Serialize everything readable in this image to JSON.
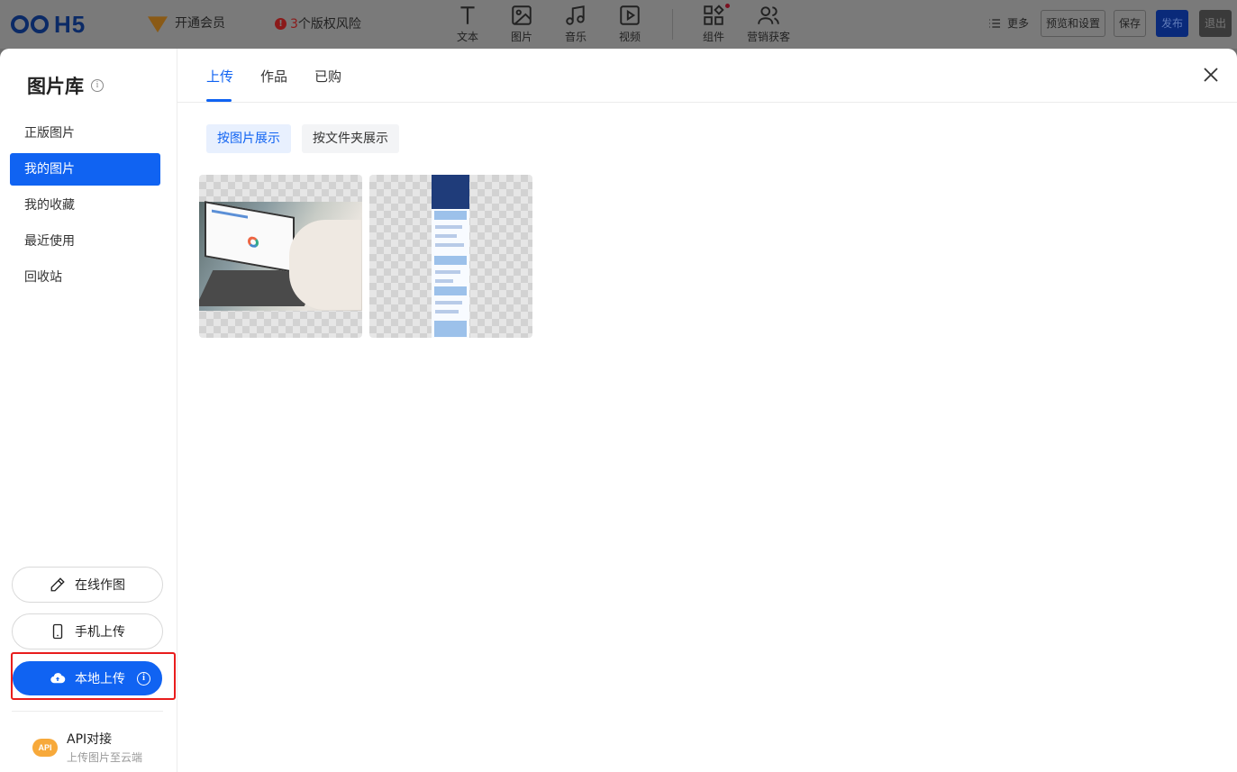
{
  "topbar": {
    "logo": "H5",
    "vip": "开通会员",
    "risk": {
      "count": "3",
      "text": "个版权风险"
    },
    "tools": [
      {
        "label": "文本",
        "icon": "text-icon"
      },
      {
        "label": "图片",
        "icon": "image-icon"
      },
      {
        "label": "音乐",
        "icon": "music-icon"
      },
      {
        "label": "视频",
        "icon": "video-icon"
      },
      {
        "label": "组件",
        "icon": "components-icon"
      },
      {
        "label": "营销获客",
        "icon": "users-icon"
      }
    ],
    "more": "更多",
    "preview": "预览和设置",
    "save": "保存",
    "publish": "发布",
    "exit": "退出"
  },
  "sidebar": {
    "title": "图片库",
    "items": [
      {
        "label": "正版图片"
      },
      {
        "label": "我的图片"
      },
      {
        "label": "我的收藏"
      },
      {
        "label": "最近使用"
      },
      {
        "label": "回收站"
      }
    ],
    "active_index": 1,
    "online_edit": "在线作图",
    "phone_upload": "手机上传",
    "local_upload": "本地上传",
    "api": {
      "icon_text": "API",
      "title": "API对接",
      "subtitle": "上传图片至云端"
    }
  },
  "main": {
    "tabs": [
      {
        "label": "上传"
      },
      {
        "label": "作品"
      },
      {
        "label": "已购"
      }
    ],
    "active_tab": 0,
    "views": [
      {
        "label": "按图片展示"
      },
      {
        "label": "按文件夹展示"
      }
    ],
    "active_view": 0
  },
  "colors": {
    "accent": "#1063f2",
    "highlight": "#e81d1d"
  }
}
